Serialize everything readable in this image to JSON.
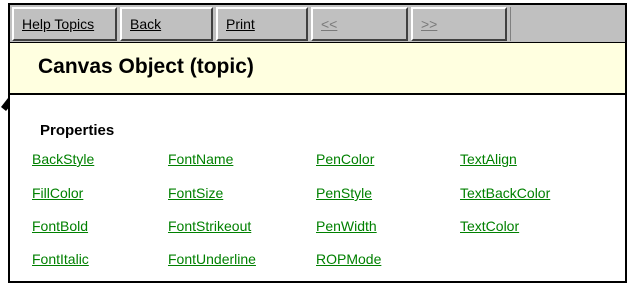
{
  "toolbar": {
    "help_topics": "Help Topics",
    "back": "Back",
    "print": "Print",
    "prev": "<<",
    "next": ">>"
  },
  "topic": {
    "title": "Canvas Object (topic)"
  },
  "properties": {
    "heading": "Properties",
    "columns": [
      [
        "BackStyle",
        "FillColor",
        "FontBold",
        "FontItalic"
      ],
      [
        "FontName",
        "FontSize",
        "FontStrikeout",
        "FontUnderline"
      ],
      [
        "PenColor",
        "PenStyle",
        "PenWidth",
        "ROPMode"
      ],
      [
        "TextAlign",
        "TextBackColor",
        "TextColor"
      ]
    ]
  },
  "colors": {
    "link": "#008000",
    "title_band": "#ffffe0",
    "toolbar": "#c0c0c0"
  }
}
